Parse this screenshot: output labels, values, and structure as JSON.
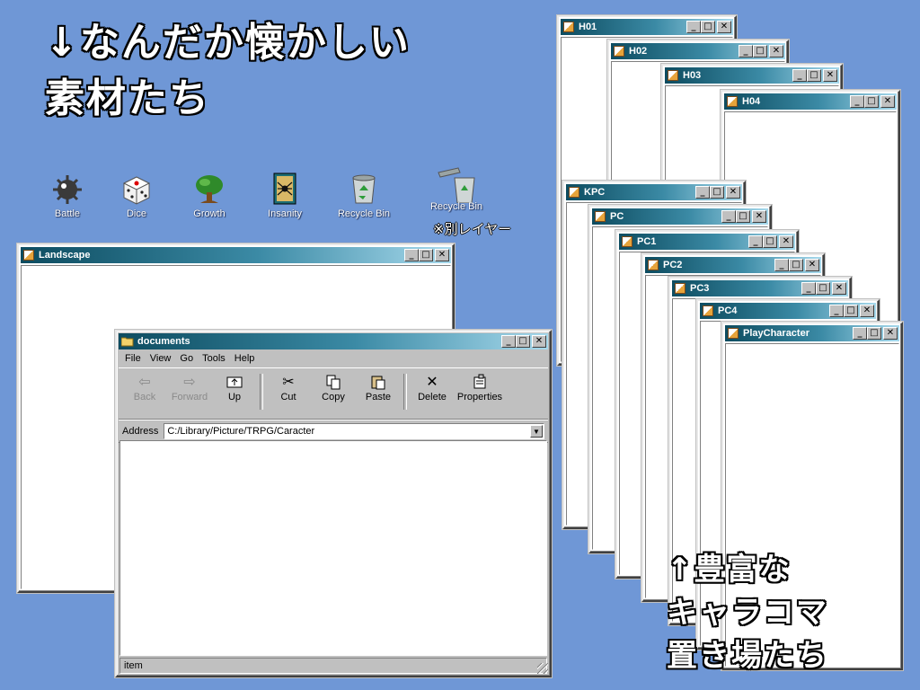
{
  "headline": {
    "line1": "↓なんだか懐かしい",
    "line2": "素材たち"
  },
  "footer_text": {
    "line1": "↑豊富な",
    "line2": "キャラコマ",
    "line3": "置き場たち"
  },
  "layer_note": "※別レイヤー",
  "desktop_icons": [
    {
      "label": "Battle",
      "icon": "bomb-icon"
    },
    {
      "label": "Dice",
      "icon": "dice-icon"
    },
    {
      "label": "Growth",
      "icon": "tree-icon"
    },
    {
      "label": "Insanity",
      "icon": "spider-card-icon"
    },
    {
      "label": "Recycle Bin",
      "icon": "recycle-bin-icon"
    },
    {
      "label": "Recycle Bin",
      "icon": "recycle-bin-open-icon"
    }
  ],
  "title_buttons": {
    "minimize": "_",
    "maximize": "□",
    "close": "✕"
  },
  "windows": {
    "h01": "H01",
    "h02": "H02",
    "h03": "H03",
    "h04": "H04",
    "kpc": "KPC",
    "pc": "PC",
    "pc1": "PC1",
    "pc2": "PC2",
    "pc3": "PC3",
    "pc4": "PC4",
    "playcharacter": "PlayCharacter",
    "landscape": "Landscape"
  },
  "explorer": {
    "title": "documents",
    "menu": [
      "File",
      "View",
      "Go",
      "Tools",
      "Help"
    ],
    "toolbar": [
      {
        "label": "Back",
        "icon": "back-arrow-icon",
        "disabled": true
      },
      {
        "label": "Forward",
        "icon": "forward-arrow-icon",
        "disabled": true
      },
      {
        "label": "Up",
        "icon": "up-folder-icon",
        "disabled": false
      },
      {
        "label": "Cut",
        "icon": "scissors-icon",
        "disabled": false
      },
      {
        "label": "Copy",
        "icon": "copy-icon",
        "disabled": false
      },
      {
        "label": "Paste",
        "icon": "paste-icon",
        "disabled": false
      },
      {
        "label": "Delete",
        "icon": "delete-x-icon",
        "disabled": false
      },
      {
        "label": "Properties",
        "icon": "properties-icon",
        "disabled": false
      }
    ],
    "address_label": "Address",
    "address_value": "C:/Library/Picture/TRPG/Caracter",
    "status": "item"
  }
}
